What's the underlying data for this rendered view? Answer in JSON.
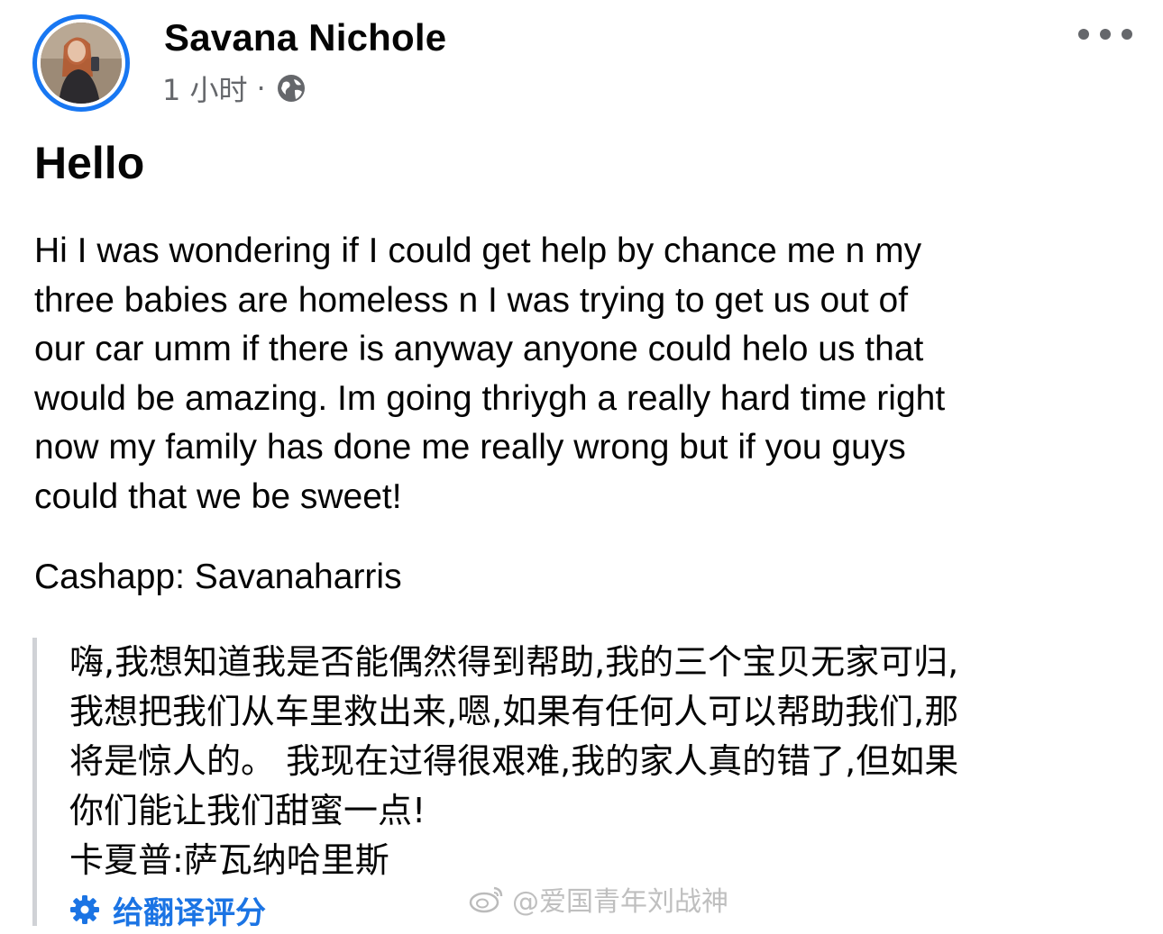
{
  "post": {
    "author": "Savana Nichole",
    "timestamp": "1 小时",
    "separator": "·",
    "audience_icon": "globe-icon",
    "more_icon": "more-horizontal-icon",
    "title": "Hello",
    "body_lines": [
      "Hi I was wondering if I could get help by chance me n my",
      "three babies are homeless n I was trying to get us out of",
      "our car umm if there is anyway anyone could helo us that",
      "would be amazing. Im going thriygh a really hard time right",
      "now my family has done me really wrong but if you guys",
      "could that we be sweet!"
    ],
    "cashapp": "Cashapp: Savanaharris"
  },
  "translation": {
    "lines": [
      "嗨,我想知道我是否能偶然得到帮助,我的三个宝贝无家可归,",
      "我想把我们从车里救出来,嗯,如果有任何人可以帮助我们,那",
      "将是惊人的。 我现在过得很艰难,我的家人真的错了,但如果",
      "你们能让我们甜蜜一点!",
      "卡夏普:萨瓦纳哈里斯"
    ],
    "rate_label": "给翻译评分",
    "rate_icon": "gear-icon"
  },
  "watermark": {
    "text": "@爱国青年刘战神",
    "icon": "weibo-icon"
  },
  "colors": {
    "accent": "#1877f2",
    "link": "#1b74e4",
    "secondary_text": "#65676b",
    "quote_bar": "#d0d2d6"
  }
}
